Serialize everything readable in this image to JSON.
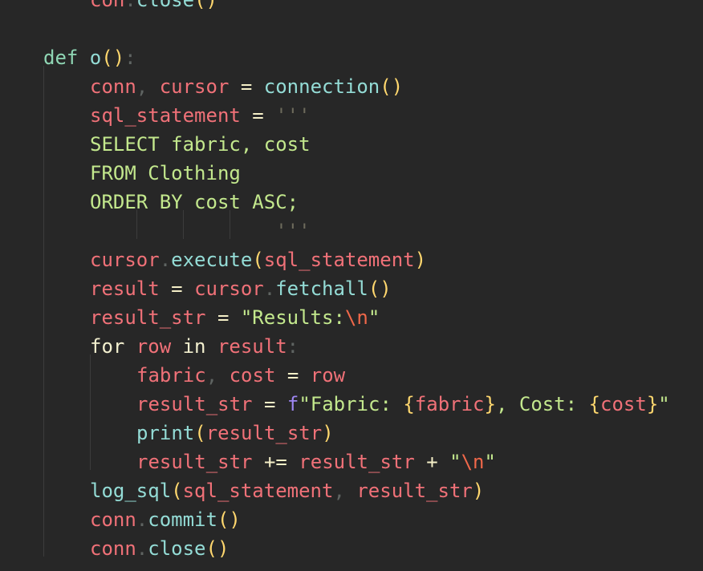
{
  "editor": {
    "language": "python",
    "theme_colors": {
      "background": "#272727",
      "string": "#c3e88d",
      "variable": "#f07178",
      "function": "#94dcd6",
      "keyword": "#8fd6b4",
      "bracket": "#ffd76e"
    },
    "lines": [
      {
        "indent": 1,
        "tokens": [
          [
            "t-var",
            "con"
          ],
          [
            "t-pun",
            "."
          ],
          [
            "t-fn",
            "close"
          ],
          [
            "t-par",
            "()"
          ]
        ],
        "partial_top": true
      },
      {
        "indent": 0,
        "tokens": []
      },
      {
        "indent": 0,
        "tokens": [
          [
            "t-def",
            "def "
          ],
          [
            "t-fn",
            "o"
          ],
          [
            "t-par",
            "()"
          ],
          [
            "t-pun",
            ":"
          ]
        ]
      },
      {
        "indent": 1,
        "tokens": [
          [
            "t-var",
            "conn"
          ],
          [
            "t-pun",
            ", "
          ],
          [
            "t-var",
            "cursor"
          ],
          [
            "t-op",
            " = "
          ],
          [
            "t-fn",
            "connection"
          ],
          [
            "t-par",
            "()"
          ]
        ]
      },
      {
        "indent": 1,
        "tokens": [
          [
            "t-var",
            "sql_statement"
          ],
          [
            "t-op",
            " = "
          ],
          [
            "t-strq",
            "'''"
          ]
        ]
      },
      {
        "indent": 1,
        "tokens": [
          [
            "t-str",
            "SELECT fabric, cost"
          ]
        ]
      },
      {
        "indent": 1,
        "tokens": [
          [
            "t-str",
            "FROM Clothing"
          ]
        ]
      },
      {
        "indent": 1,
        "tokens": [
          [
            "t-str",
            "ORDER BY cost ASC;"
          ]
        ]
      },
      {
        "indent": 1,
        "tokens": [
          [
            "t-str",
            "                "
          ],
          [
            "t-strq",
            "'''"
          ]
        ]
      },
      {
        "indent": 1,
        "tokens": [
          [
            "t-var",
            "cursor"
          ],
          [
            "t-pun",
            "."
          ],
          [
            "t-fn",
            "execute"
          ],
          [
            "t-par",
            "("
          ],
          [
            "t-var",
            "sql_statement"
          ],
          [
            "t-par",
            ")"
          ]
        ]
      },
      {
        "indent": 1,
        "tokens": [
          [
            "t-var",
            "result"
          ],
          [
            "t-op",
            " = "
          ],
          [
            "t-var",
            "cursor"
          ],
          [
            "t-pun",
            "."
          ],
          [
            "t-fn",
            "fetchall"
          ],
          [
            "t-par",
            "()"
          ]
        ]
      },
      {
        "indent": 1,
        "tokens": [
          [
            "t-var",
            "result_str"
          ],
          [
            "t-op",
            " = "
          ],
          [
            "t-str",
            "\"Results:"
          ],
          [
            "t-esc",
            "\\n"
          ],
          [
            "t-str",
            "\""
          ]
        ]
      },
      {
        "indent": 1,
        "tokens": [
          [
            "t-ctl",
            "for "
          ],
          [
            "t-var",
            "row"
          ],
          [
            "t-ctl",
            " in "
          ],
          [
            "t-var",
            "result"
          ],
          [
            "t-pun",
            ":"
          ]
        ]
      },
      {
        "indent": 2,
        "tokens": [
          [
            "t-var",
            "fabric"
          ],
          [
            "t-pun",
            ", "
          ],
          [
            "t-var",
            "cost"
          ],
          [
            "t-op",
            " = "
          ],
          [
            "t-var",
            "row"
          ]
        ]
      },
      {
        "indent": 2,
        "tokens": [
          [
            "t-var",
            "result_str"
          ],
          [
            "t-op",
            " = "
          ],
          [
            "t-fpre",
            "f"
          ],
          [
            "t-str",
            "\"Fabric: "
          ],
          [
            "t-brc",
            "{"
          ],
          [
            "t-var",
            "fabric"
          ],
          [
            "t-brc",
            "}"
          ],
          [
            "t-str",
            ", Cost: "
          ],
          [
            "t-brc",
            "{"
          ],
          [
            "t-var",
            "cost"
          ],
          [
            "t-brc",
            "}"
          ],
          [
            "t-str",
            "\""
          ]
        ]
      },
      {
        "indent": 2,
        "tokens": [
          [
            "t-fn",
            "print"
          ],
          [
            "t-par",
            "("
          ],
          [
            "t-var",
            "result_str"
          ],
          [
            "t-par",
            ")"
          ]
        ]
      },
      {
        "indent": 2,
        "tokens": [
          [
            "t-var",
            "result_str"
          ],
          [
            "t-op",
            " += "
          ],
          [
            "t-var",
            "result_str"
          ],
          [
            "t-op",
            " + "
          ],
          [
            "t-str",
            "\""
          ],
          [
            "t-esc",
            "\\n"
          ],
          [
            "t-str",
            "\""
          ]
        ]
      },
      {
        "indent": 1,
        "tokens": [
          [
            "t-fn",
            "log_sql"
          ],
          [
            "t-par",
            "("
          ],
          [
            "t-var",
            "sql_statement"
          ],
          [
            "t-pun",
            ", "
          ],
          [
            "t-var",
            "result_str"
          ],
          [
            "t-par",
            ")"
          ]
        ]
      },
      {
        "indent": 1,
        "tokens": [
          [
            "t-var",
            "conn"
          ],
          [
            "t-pun",
            "."
          ],
          [
            "t-fn",
            "commit"
          ],
          [
            "t-par",
            "()"
          ]
        ]
      },
      {
        "indent": 1,
        "tokens": [
          [
            "t-var",
            "conn"
          ],
          [
            "t-pun",
            "."
          ],
          [
            "t-fn",
            "close"
          ],
          [
            "t-par",
            "()"
          ]
        ]
      }
    ]
  }
}
